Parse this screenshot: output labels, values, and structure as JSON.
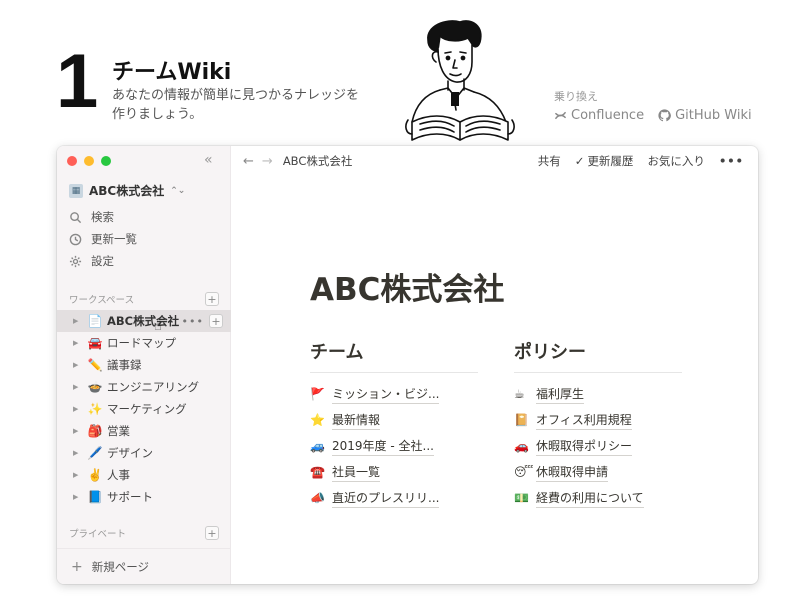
{
  "hero": {
    "number": "1",
    "title": "チームWiki",
    "desc_line1": "あなたの情報が簡単に見つかるナレッジを",
    "desc_line2": "作りましょう。"
  },
  "switch": {
    "label": "乗り換え",
    "items": [
      {
        "name": "Confluence",
        "icon": "confluence-icon"
      },
      {
        "name": "GitHub Wiki",
        "icon": "github-icon"
      }
    ]
  },
  "colors": {
    "close": "#ff5f57",
    "minimize": "#febc2e",
    "maximize": "#28c840"
  },
  "sidebar": {
    "workspace_name": "ABC株式会社",
    "menu": [
      {
        "label": "検索",
        "icon": "search-icon"
      },
      {
        "label": "更新一覧",
        "icon": "clock-icon"
      },
      {
        "label": "設定",
        "icon": "gear-icon"
      }
    ],
    "workspace_section": "ワークスペース",
    "tree": [
      {
        "label": "ABC株式会社",
        "emoji": "📄",
        "active": true
      },
      {
        "label": "ロードマップ",
        "emoji": "🚘"
      },
      {
        "label": "議事録",
        "emoji": "✏️"
      },
      {
        "label": "エンジニアリング",
        "emoji": "🍲"
      },
      {
        "label": "マーケティング",
        "emoji": "✨"
      },
      {
        "label": "営業",
        "emoji": "🎒"
      },
      {
        "label": "デザイン",
        "emoji": "🖊️"
      },
      {
        "label": "人事",
        "emoji": "✌️"
      },
      {
        "label": "サポート",
        "emoji": "📘"
      }
    ],
    "private_section": "プライベート",
    "new_page": "新規ページ"
  },
  "topbar": {
    "breadcrumb": "ABC株式会社",
    "share": "共有",
    "history": "更新履歴",
    "favorite": "お気に入り"
  },
  "page": {
    "title": "ABC株式会社",
    "columns": [
      {
        "heading": "チーム",
        "links": [
          {
            "emoji": "🚩",
            "text": "ミッション・ビジ..."
          },
          {
            "emoji": "⭐",
            "text": "最新情報"
          },
          {
            "emoji": "🚙",
            "text": "2019年度 - 全社..."
          },
          {
            "emoji": "☎️",
            "text": "社員一覧"
          },
          {
            "emoji": "📣",
            "text": "直近のプレスリリ..."
          }
        ]
      },
      {
        "heading": "ポリシー",
        "links": [
          {
            "emoji": "☕",
            "text": "福利厚生"
          },
          {
            "emoji": "📔",
            "text": "オフィス利用規程"
          },
          {
            "emoji": "🚗",
            "text": "休暇取得ポリシー"
          },
          {
            "emoji": "😴",
            "text": "休暇取得申請"
          },
          {
            "emoji": "💵",
            "text": "経費の利用について"
          }
        ]
      }
    ]
  }
}
